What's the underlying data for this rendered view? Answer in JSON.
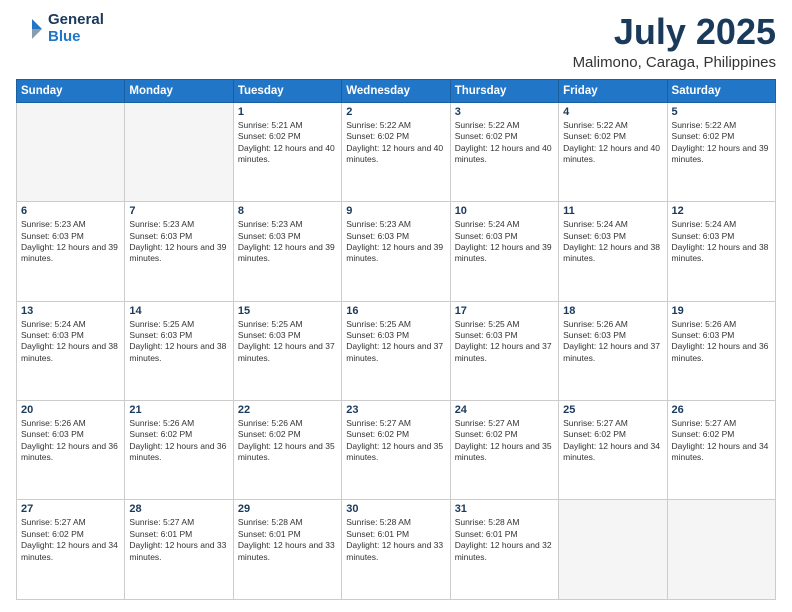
{
  "header": {
    "logo_line1": "General",
    "logo_line2": "Blue",
    "month": "July 2025",
    "location": "Malimono, Caraga, Philippines"
  },
  "weekdays": [
    "Sunday",
    "Monday",
    "Tuesday",
    "Wednesday",
    "Thursday",
    "Friday",
    "Saturday"
  ],
  "weeks": [
    [
      {
        "day": "",
        "sunrise": "",
        "sunset": "",
        "daylight": ""
      },
      {
        "day": "",
        "sunrise": "",
        "sunset": "",
        "daylight": ""
      },
      {
        "day": "1",
        "sunrise": "Sunrise: 5:21 AM",
        "sunset": "Sunset: 6:02 PM",
        "daylight": "Daylight: 12 hours and 40 minutes."
      },
      {
        "day": "2",
        "sunrise": "Sunrise: 5:22 AM",
        "sunset": "Sunset: 6:02 PM",
        "daylight": "Daylight: 12 hours and 40 minutes."
      },
      {
        "day": "3",
        "sunrise": "Sunrise: 5:22 AM",
        "sunset": "Sunset: 6:02 PM",
        "daylight": "Daylight: 12 hours and 40 minutes."
      },
      {
        "day": "4",
        "sunrise": "Sunrise: 5:22 AM",
        "sunset": "Sunset: 6:02 PM",
        "daylight": "Daylight: 12 hours and 40 minutes."
      },
      {
        "day": "5",
        "sunrise": "Sunrise: 5:22 AM",
        "sunset": "Sunset: 6:02 PM",
        "daylight": "Daylight: 12 hours and 39 minutes."
      }
    ],
    [
      {
        "day": "6",
        "sunrise": "Sunrise: 5:23 AM",
        "sunset": "Sunset: 6:03 PM",
        "daylight": "Daylight: 12 hours and 39 minutes."
      },
      {
        "day": "7",
        "sunrise": "Sunrise: 5:23 AM",
        "sunset": "Sunset: 6:03 PM",
        "daylight": "Daylight: 12 hours and 39 minutes."
      },
      {
        "day": "8",
        "sunrise": "Sunrise: 5:23 AM",
        "sunset": "Sunset: 6:03 PM",
        "daylight": "Daylight: 12 hours and 39 minutes."
      },
      {
        "day": "9",
        "sunrise": "Sunrise: 5:23 AM",
        "sunset": "Sunset: 6:03 PM",
        "daylight": "Daylight: 12 hours and 39 minutes."
      },
      {
        "day": "10",
        "sunrise": "Sunrise: 5:24 AM",
        "sunset": "Sunset: 6:03 PM",
        "daylight": "Daylight: 12 hours and 39 minutes."
      },
      {
        "day": "11",
        "sunrise": "Sunrise: 5:24 AM",
        "sunset": "Sunset: 6:03 PM",
        "daylight": "Daylight: 12 hours and 38 minutes."
      },
      {
        "day": "12",
        "sunrise": "Sunrise: 5:24 AM",
        "sunset": "Sunset: 6:03 PM",
        "daylight": "Daylight: 12 hours and 38 minutes."
      }
    ],
    [
      {
        "day": "13",
        "sunrise": "Sunrise: 5:24 AM",
        "sunset": "Sunset: 6:03 PM",
        "daylight": "Daylight: 12 hours and 38 minutes."
      },
      {
        "day": "14",
        "sunrise": "Sunrise: 5:25 AM",
        "sunset": "Sunset: 6:03 PM",
        "daylight": "Daylight: 12 hours and 38 minutes."
      },
      {
        "day": "15",
        "sunrise": "Sunrise: 5:25 AM",
        "sunset": "Sunset: 6:03 PM",
        "daylight": "Daylight: 12 hours and 37 minutes."
      },
      {
        "day": "16",
        "sunrise": "Sunrise: 5:25 AM",
        "sunset": "Sunset: 6:03 PM",
        "daylight": "Daylight: 12 hours and 37 minutes."
      },
      {
        "day": "17",
        "sunrise": "Sunrise: 5:25 AM",
        "sunset": "Sunset: 6:03 PM",
        "daylight": "Daylight: 12 hours and 37 minutes."
      },
      {
        "day": "18",
        "sunrise": "Sunrise: 5:26 AM",
        "sunset": "Sunset: 6:03 PM",
        "daylight": "Daylight: 12 hours and 37 minutes."
      },
      {
        "day": "19",
        "sunrise": "Sunrise: 5:26 AM",
        "sunset": "Sunset: 6:03 PM",
        "daylight": "Daylight: 12 hours and 36 minutes."
      }
    ],
    [
      {
        "day": "20",
        "sunrise": "Sunrise: 5:26 AM",
        "sunset": "Sunset: 6:03 PM",
        "daylight": "Daylight: 12 hours and 36 minutes."
      },
      {
        "day": "21",
        "sunrise": "Sunrise: 5:26 AM",
        "sunset": "Sunset: 6:02 PM",
        "daylight": "Daylight: 12 hours and 36 minutes."
      },
      {
        "day": "22",
        "sunrise": "Sunrise: 5:26 AM",
        "sunset": "Sunset: 6:02 PM",
        "daylight": "Daylight: 12 hours and 35 minutes."
      },
      {
        "day": "23",
        "sunrise": "Sunrise: 5:27 AM",
        "sunset": "Sunset: 6:02 PM",
        "daylight": "Daylight: 12 hours and 35 minutes."
      },
      {
        "day": "24",
        "sunrise": "Sunrise: 5:27 AM",
        "sunset": "Sunset: 6:02 PM",
        "daylight": "Daylight: 12 hours and 35 minutes."
      },
      {
        "day": "25",
        "sunrise": "Sunrise: 5:27 AM",
        "sunset": "Sunset: 6:02 PM",
        "daylight": "Daylight: 12 hours and 34 minutes."
      },
      {
        "day": "26",
        "sunrise": "Sunrise: 5:27 AM",
        "sunset": "Sunset: 6:02 PM",
        "daylight": "Daylight: 12 hours and 34 minutes."
      }
    ],
    [
      {
        "day": "27",
        "sunrise": "Sunrise: 5:27 AM",
        "sunset": "Sunset: 6:02 PM",
        "daylight": "Daylight: 12 hours and 34 minutes."
      },
      {
        "day": "28",
        "sunrise": "Sunrise: 5:27 AM",
        "sunset": "Sunset: 6:01 PM",
        "daylight": "Daylight: 12 hours and 33 minutes."
      },
      {
        "day": "29",
        "sunrise": "Sunrise: 5:28 AM",
        "sunset": "Sunset: 6:01 PM",
        "daylight": "Daylight: 12 hours and 33 minutes."
      },
      {
        "day": "30",
        "sunrise": "Sunrise: 5:28 AM",
        "sunset": "Sunset: 6:01 PM",
        "daylight": "Daylight: 12 hours and 33 minutes."
      },
      {
        "day": "31",
        "sunrise": "Sunrise: 5:28 AM",
        "sunset": "Sunset: 6:01 PM",
        "daylight": "Daylight: 12 hours and 32 minutes."
      },
      {
        "day": "",
        "sunrise": "",
        "sunset": "",
        "daylight": ""
      },
      {
        "day": "",
        "sunrise": "",
        "sunset": "",
        "daylight": ""
      }
    ]
  ]
}
